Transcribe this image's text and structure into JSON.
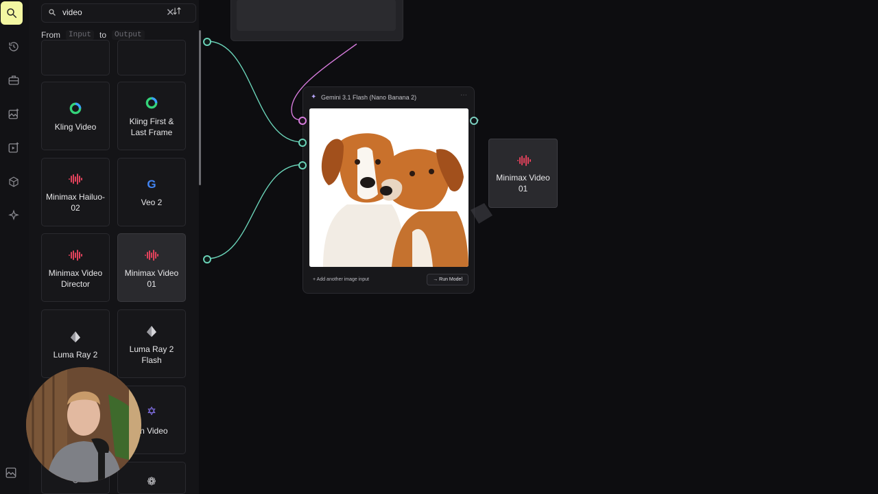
{
  "search": {
    "value": "video",
    "clear": "✕"
  },
  "filter": {
    "from": "From",
    "input": "Input",
    "to": "to",
    "output": "Output"
  },
  "models": [
    {
      "label": "Kling Video",
      "icon": "kling-icon"
    },
    {
      "label": "Kling First & Last Frame",
      "icon": "kling-icon"
    },
    {
      "label": "Minimax Hailuo-02",
      "icon": "minimax-icon"
    },
    {
      "label": "Veo 2",
      "icon": "google-icon"
    },
    {
      "label": "Minimax Video Director",
      "icon": "minimax-icon"
    },
    {
      "label": "Minimax Video 01",
      "icon": "minimax-icon"
    },
    {
      "label": "Luma Ray 2",
      "icon": "luma-icon"
    },
    {
      "label": "Luma Ray 2 Flash",
      "icon": "luma-icon"
    },
    {
      "label": "an Video",
      "icon": "star-icon"
    }
  ],
  "node": {
    "title": "Gemini 3.1 Flash (Nano Banana 2)",
    "add_input": "+ Add another image input",
    "run": "→ Run Model",
    "menu": "···"
  },
  "output_node": {
    "label": "Minimax Video 01"
  },
  "colors": {
    "accent": "#f3f7a2",
    "edge": "#6ad3b8",
    "edge_pink": "#d67bdc",
    "minimax": "#e0425b"
  }
}
